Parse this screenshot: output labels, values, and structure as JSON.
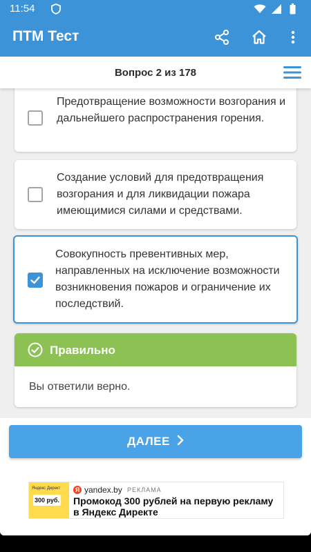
{
  "status_bar": {
    "time": "11:54"
  },
  "app_bar": {
    "title": "ПТМ Тест"
  },
  "question_header": {
    "label": "Вопрос 2 из 178"
  },
  "answers": [
    {
      "text": "Предотвращение возможности возгорания и дальнейшего распространения горения.",
      "checked": false
    },
    {
      "text": "Создание условий для предотвращения возгорания и для ликвидации пожара имеющимися силами и средствами.",
      "checked": false
    },
    {
      "text": "Совокупность превентивных мер, направленных на исключение возможности возникновения пожаров и ограничение их последствий.",
      "checked": true
    }
  ],
  "result": {
    "title": "Правильно",
    "message": "Вы ответили верно."
  },
  "next_button": {
    "label": "ДАЛЕЕ"
  },
  "ad": {
    "thumb_brand": "Яндекс Директ",
    "thumb_price": "300 руб.",
    "logo_letter": "Я",
    "domain": "yandex.by",
    "tag": "РЕКЛАМА",
    "headline": "Промокод 300 рублей на первую рекламу в Яндекс Директе"
  },
  "colors": {
    "accent": "#3d93d8",
    "success": "#8cc153",
    "button": "#4aa3e6"
  }
}
